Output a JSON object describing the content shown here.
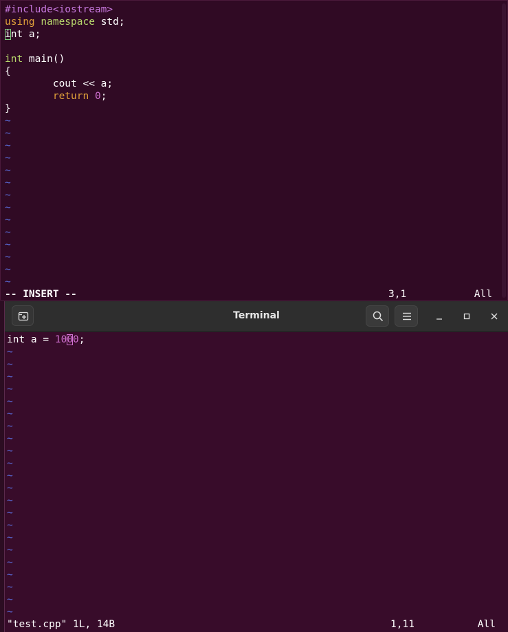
{
  "top_editor": {
    "lines": {
      "l1": {
        "directive": "#include",
        "header": "<iostream>"
      },
      "l2": {
        "kw_using": "using",
        "kw_namespace": "namespace",
        "rest": " std;"
      },
      "l3": {
        "cursor_char": "i",
        "rest": "nt a;"
      },
      "l5": {
        "kw": "int",
        "rest": " main()"
      },
      "l6": "{",
      "l7": "        cout << a;",
      "l8": {
        "indent": "        ",
        "kw": "return",
        "num": "0",
        "semi": ";"
      },
      "l9": "}"
    },
    "tilde": "~",
    "status": {
      "mode": "-- INSERT --",
      "position": "3,1",
      "scroll": "All"
    }
  },
  "terminal": {
    "title": "Terminal",
    "buttons": {
      "new_tab": "new-tab-icon",
      "search": "search-icon",
      "menu": "hamburger-menu-icon",
      "minimize": "minimize-icon",
      "maximize": "maximize-icon",
      "close": "close-icon"
    },
    "editor": {
      "line1": {
        "prefix": "int a = ",
        "num_a": "10",
        "num_cursor": "0",
        "num_b": "0",
        "suffix": ";"
      },
      "tilde": "~",
      "status": {
        "message": "\"test.cpp\" 1L, 14B",
        "position": "1,11",
        "scroll": "All"
      }
    }
  },
  "colors": {
    "background": "#300a24",
    "keyword_purple": "#c678dd",
    "keyword_orange": "#e0a03a",
    "tilde_blue": "#5a6bd8"
  }
}
